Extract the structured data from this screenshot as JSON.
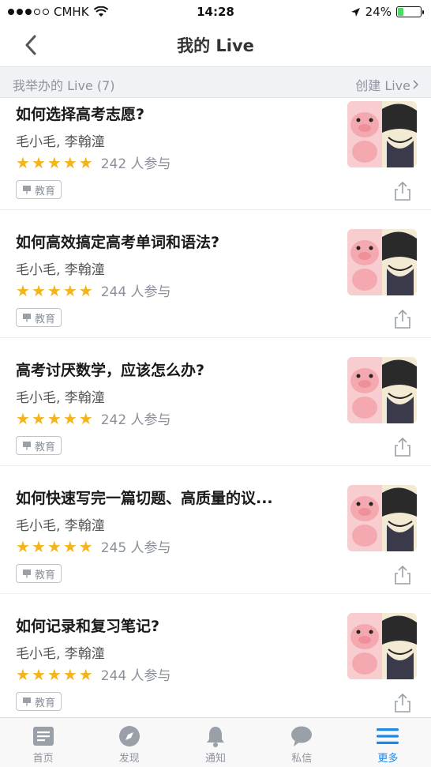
{
  "status_bar": {
    "carrier": "CMHK",
    "time": "14:28",
    "battery": "24%",
    "battery_level": 0.24
  },
  "nav": {
    "title": "我的 Live"
  },
  "subheader": {
    "left": "我举办的 Live (7)",
    "right": "创建 Live"
  },
  "items": [
    {
      "title": "如何选择高考志愿?",
      "speakers": "毛小毛, 李翰潼",
      "rating": 5,
      "participants": "242 人参与",
      "tag": "教育"
    },
    {
      "title": "如何高效搞定高考单词和语法?",
      "speakers": "毛小毛, 李翰潼",
      "rating": 5,
      "participants": "244 人参与",
      "tag": "教育"
    },
    {
      "title": "高考讨厌数学，应该怎么办?",
      "speakers": "毛小毛, 李翰潼",
      "rating": 5,
      "participants": "242 人参与",
      "tag": "教育"
    },
    {
      "title": "如何快速写完一篇切题、高质量的议...",
      "speakers": "毛小毛, 李翰潼",
      "rating": 5,
      "participants": "245 人参与",
      "tag": "教育"
    },
    {
      "title": "如何记录和复习笔记?",
      "speakers": "毛小毛, 李翰潼",
      "rating": 5,
      "participants": "244 人参与",
      "tag": "教育"
    }
  ],
  "tabbar": {
    "tabs": [
      {
        "label": "首页",
        "icon": "home-icon"
      },
      {
        "label": "发现",
        "icon": "compass-icon"
      },
      {
        "label": "通知",
        "icon": "bell-icon"
      },
      {
        "label": "私信",
        "icon": "chat-icon"
      },
      {
        "label": "更多",
        "icon": "menu-icon",
        "active": true
      }
    ]
  },
  "colors": {
    "accent": "#1e88e5",
    "star": "#f4b41a"
  }
}
